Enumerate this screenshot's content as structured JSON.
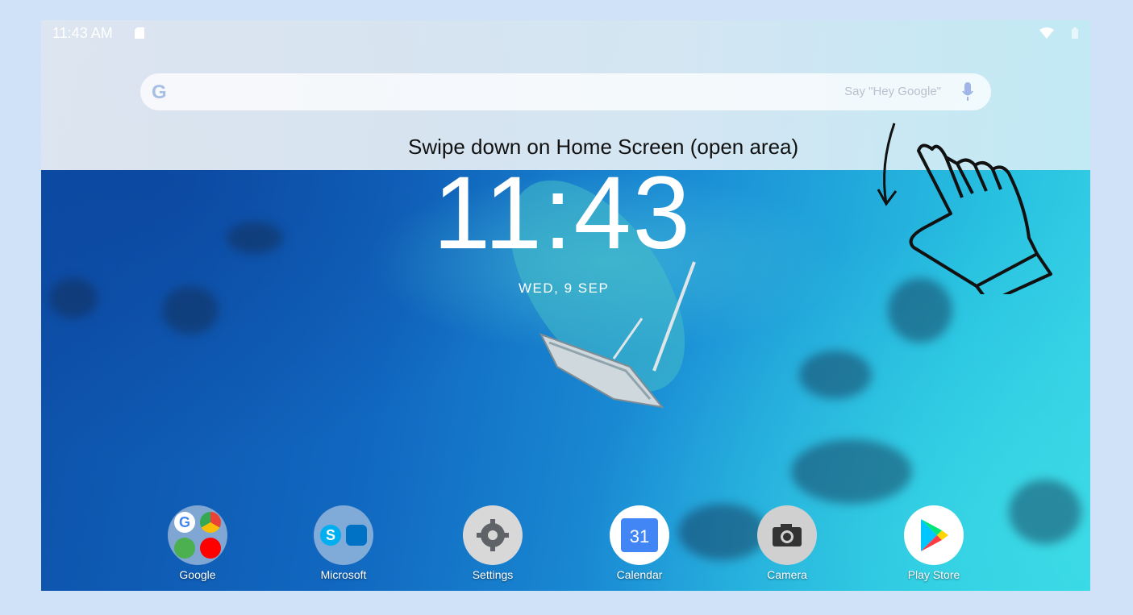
{
  "status_bar": {
    "time": "11:43 AM"
  },
  "search": {
    "logo": "G",
    "hint": "Say \"Hey Google\""
  },
  "instruction": "Swipe down on Home Screen (open area)",
  "clock": {
    "time": "11:43",
    "date": "WED, 9 SEP"
  },
  "dock": [
    {
      "label": "Google",
      "icon": "google-folder-icon"
    },
    {
      "label": "Microsoft",
      "icon": "microsoft-folder-icon"
    },
    {
      "label": "Settings",
      "icon": "settings-icon"
    },
    {
      "label": "Calendar",
      "icon": "calendar-icon",
      "badge": "31"
    },
    {
      "label": "Camera",
      "icon": "camera-icon"
    },
    {
      "label": "Play Store",
      "icon": "play-store-icon"
    }
  ]
}
